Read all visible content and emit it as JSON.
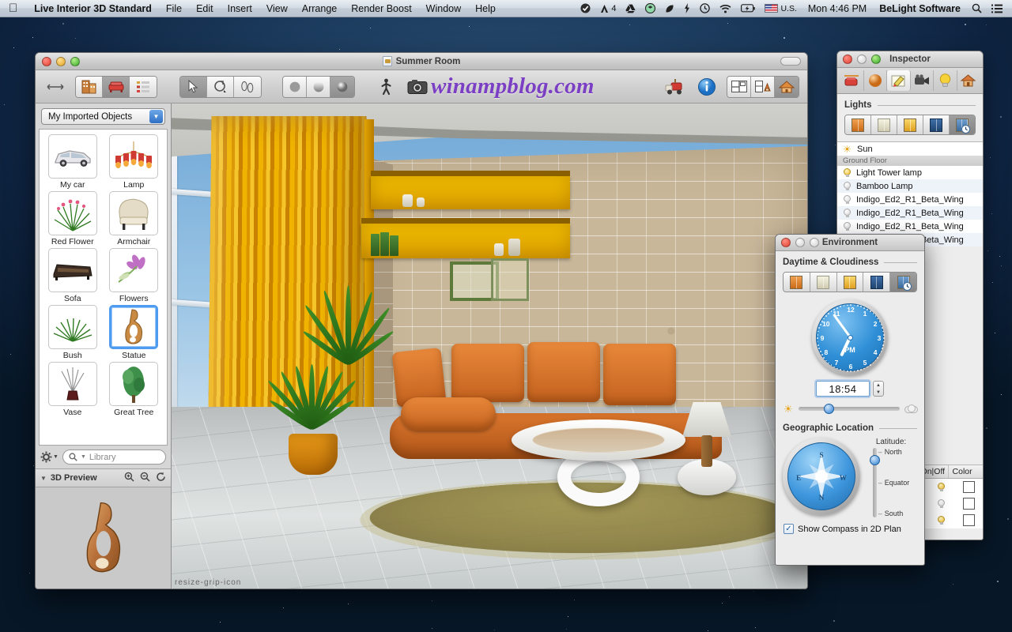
{
  "menubar": {
    "apple_icon": "apple-logo",
    "app_name": "Live Interior 3D Standard",
    "menus": [
      "File",
      "Edit",
      "Insert",
      "View",
      "Arrange",
      "Render Boost",
      "Window",
      "Help"
    ],
    "status_icons": [
      "checkmark-badge-icon",
      "adobe-icon",
      "google-drive-icon",
      "dropbox-icon",
      "evernote-icon",
      "flash-icon",
      "time-machine-icon",
      "wifi-icon",
      "battery-icon"
    ],
    "adobe_count": "4",
    "input_flag": "us-flag-icon",
    "input_label": "U.S.",
    "clock": "Mon 4:46 PM",
    "vendor": "BeLight Software",
    "search_icon": "spotlight-search-icon",
    "list_icon": "notification-center-icon"
  },
  "main_window": {
    "title": "Summer Room",
    "watermark": "winampblog.com",
    "toolbar": {
      "arrows_icon": "left-right-arrows-icon",
      "view_group": [
        "building-icon",
        "furniture-icon",
        "list-icon"
      ],
      "tool_group": [
        "arrow-select-icon",
        "rotate-icon",
        "walk-feet-icon"
      ],
      "render_group": [
        "flat-shading-icon",
        "gradient-shading-icon",
        "realistic-shading-icon"
      ],
      "walk_icon": "walkthrough-icon",
      "camera_icon": "camera-icon",
      "render_icon": "render-truck-icon",
      "info_icon": "info-icon",
      "layout_group": [
        "2d-plan-icon",
        "split-view-icon",
        "3d-view-icon"
      ],
      "resize_pill": "window-resize-pill"
    }
  },
  "sidebar": {
    "library_popup": {
      "value": "My Imported Objects",
      "arrow_icon": "chevron-down-icon"
    },
    "objects": [
      {
        "label": "My car",
        "icon": "car-icon",
        "selected": false
      },
      {
        "label": "Lamp",
        "icon": "chandelier-icon",
        "selected": false
      },
      {
        "label": "Red Flower",
        "icon": "red-flower-icon",
        "selected": false
      },
      {
        "label": "Armchair",
        "icon": "armchair-icon",
        "selected": false
      },
      {
        "label": "Sofa",
        "icon": "sofa-icon",
        "selected": false
      },
      {
        "label": "Flowers",
        "icon": "flowers-icon",
        "selected": false
      },
      {
        "label": "Bush",
        "icon": "bush-icon",
        "selected": false
      },
      {
        "label": "Statue",
        "icon": "statue-icon",
        "selected": true
      },
      {
        "label": "Vase",
        "icon": "vase-icon",
        "selected": false
      },
      {
        "label": "Great Tree",
        "icon": "tree-icon",
        "selected": false
      }
    ],
    "gear_icon": "gear-icon",
    "search": {
      "placeholder": "Library",
      "icon": "magnifier-icon"
    },
    "preview": {
      "title": "3D Preview",
      "disclosure_icon": "disclosure-triangle-icon",
      "zoom_in_icon": "zoom-in-icon",
      "zoom_out_icon": "zoom-out-icon",
      "rotate_icon": "rotate-refresh-icon",
      "object_icon": "statue-preview-icon"
    },
    "resize_grip": "resize-grip-icon"
  },
  "inspector": {
    "title": "Inspector",
    "tabs": [
      {
        "icon": "plan-object-icon",
        "selected": false
      },
      {
        "icon": "material-sphere-icon",
        "selected": false
      },
      {
        "icon": "edit-pencil-icon",
        "selected": true
      },
      {
        "icon": "camera-video-icon",
        "selected": false
      },
      {
        "icon": "light-bulb-icon",
        "selected": false
      },
      {
        "icon": "house-icon",
        "selected": false
      }
    ],
    "section_title": "Lights",
    "presets": [
      {
        "icon": "lighting-preset-1",
        "selected": false
      },
      {
        "icon": "lighting-preset-2",
        "selected": false
      },
      {
        "icon": "lighting-preset-3",
        "selected": false
      },
      {
        "icon": "lighting-preset-4",
        "selected": false
      },
      {
        "icon": "lighting-preset-time",
        "selected": true
      }
    ],
    "lights": [
      {
        "label": "Sun",
        "icon": "sun-icon",
        "type": "sun"
      },
      {
        "label": "Ground Floor",
        "type": "group"
      },
      {
        "label": "Light Tower lamp",
        "icon": "bulb-on-icon",
        "type": "light",
        "on": true
      },
      {
        "label": "Bamboo Lamp",
        "icon": "bulb-off-icon",
        "type": "light",
        "on": false
      },
      {
        "label": "Indigo_Ed2_R1_Beta_Wing",
        "icon": "bulb-off-icon",
        "type": "light",
        "on": false
      },
      {
        "label": "Indigo_Ed2_R1_Beta_Wing",
        "icon": "bulb-off-icon",
        "type": "light",
        "on": false
      },
      {
        "label": "Indigo_Ed2_R1_Beta_Wing",
        "icon": "bulb-off-icon",
        "type": "light",
        "on": false
      },
      {
        "label": "Indigo_Ed2_R1_Beta_Wing",
        "icon": "bulb-off-icon",
        "type": "light",
        "on": false
      }
    ],
    "table": {
      "columns": [
        "On|Off",
        "Color"
      ],
      "rows": [
        {
          "on": true,
          "color": "#ffffff"
        },
        {
          "on": false,
          "color": "#ffffff"
        },
        {
          "on": true,
          "color": "#ffffff"
        }
      ]
    }
  },
  "environment": {
    "title": "Environment",
    "daytime_section": "Daytime & Cloudiness",
    "presets": [
      {
        "icon": "daytime-preset-sunrise",
        "selected": false
      },
      {
        "icon": "daytime-preset-day",
        "selected": false
      },
      {
        "icon": "daytime-preset-sunset",
        "selected": false
      },
      {
        "icon": "daytime-preset-night",
        "selected": false
      },
      {
        "icon": "daytime-preset-custom-time",
        "selected": true
      }
    ],
    "clock": {
      "numbers": [
        "12",
        "1",
        "2",
        "3",
        "4",
        "5",
        "6",
        "7",
        "8",
        "9",
        "10",
        "11"
      ],
      "meridiem": "PM",
      "hour_angle": 205,
      "minute_angle": 324
    },
    "time_value": "18:54",
    "stepper": {
      "up_icon": "stepper-up-icon",
      "down_icon": "stepper-down-icon"
    },
    "cloud_slider": {
      "sun_icon": "mini-sun-icon",
      "cloud_icon": "mini-cloud-icon",
      "position_percent": 30
    },
    "geo_section": "Geographic Location",
    "compass": {
      "icon": "compass-rose-icon",
      "letters": [
        "N",
        "E",
        "S",
        "W"
      ]
    },
    "latitude": {
      "label": "Latitude:",
      "ticks": [
        "North",
        "Equator",
        "South"
      ],
      "knob_percent": 18
    },
    "checkbox": {
      "label": "Show Compass in 2D Plan",
      "checked": true,
      "check_icon": "checkmark-icon"
    }
  },
  "colors": {
    "accent_blue": "#2f7fd0",
    "selection_blue": "#4e9bf0",
    "sofa_orange": "#d9752c",
    "curtain_gold": "#f0b400",
    "stone_wall": "#c9b79a",
    "shelf_yellow": "#f5c200",
    "watermark_purple": "#7b3fc4"
  }
}
